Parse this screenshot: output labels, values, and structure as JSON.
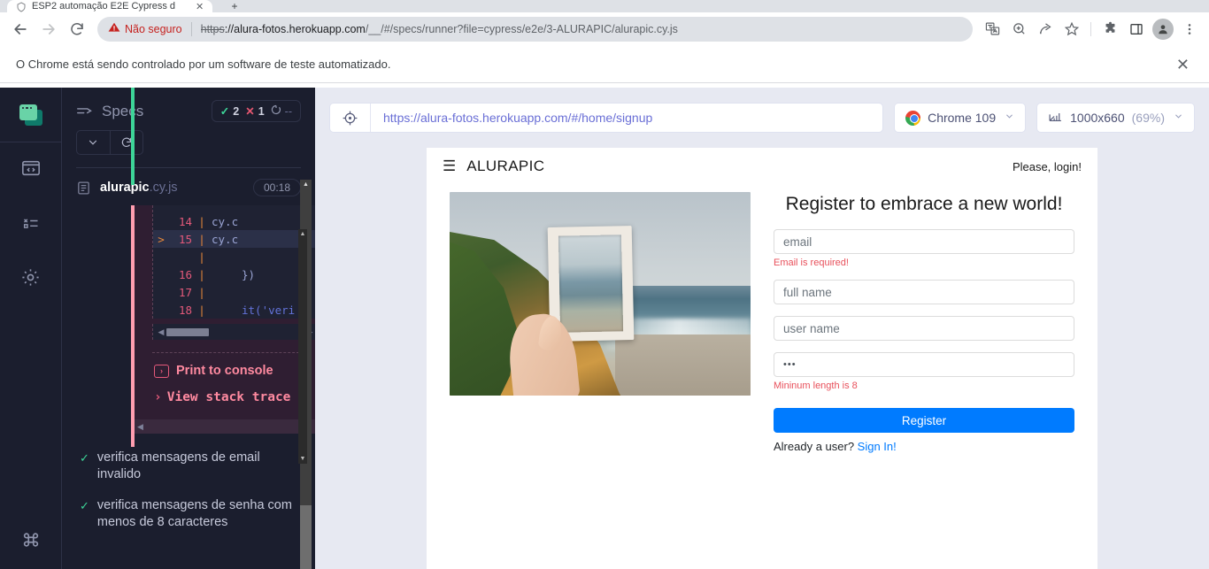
{
  "browser": {
    "tab": {
      "title": "ESP2 automação E2E Cypress d",
      "favicon_name": "shield-icon",
      "close_label": "✕"
    },
    "new_tab_label": "+",
    "nav": {
      "back": "←",
      "forward": "→",
      "reload": "⟳"
    },
    "omnibox": {
      "security_label": "Não seguro",
      "security_icon": "warning-triangle-icon",
      "url_scheme": "https",
      "url_rest": "://alura-fotos.herokuapp.com/__/#/specs/runner?file=cypress/e2e/3-ALURAPIC/alurapic.cy.js",
      "url_host": "://alura-fotos.herokuapp.com",
      "url_path": "/__/#/specs/runner?file=cypress/e2e/3-ALURAPIC/alurapic.cy.js"
    },
    "toolbar_icons": [
      "translate-icon",
      "zoom-icon",
      "share-icon",
      "bookmark-star-icon",
      "extensions-puzzle-icon",
      "side-panel-icon",
      "profile-avatar-icon",
      "three-dot-menu-icon"
    ],
    "infobar": {
      "message": "O Chrome está sendo controlado por um software de teste automatizado.",
      "close_label": "✕"
    }
  },
  "cypress": {
    "rail": [
      {
        "name": "cypress-logo",
        "label": "Cypress"
      },
      {
        "name": "specs-code-icon",
        "label": "Specs"
      },
      {
        "name": "runs-icon",
        "label": "Runs"
      },
      {
        "name": "settings-gear-icon",
        "label": "Settings"
      },
      {
        "name": "keyboard-shortcuts-icon",
        "label": "⌘"
      }
    ],
    "reporter": {
      "specs_label": "Specs",
      "stats": {
        "passed_icon": "✓",
        "passed": "2",
        "failed_icon": "✕",
        "failed": "1",
        "pending_icon": "◴",
        "pending": "--"
      },
      "collapse_label": "⌄",
      "restart_label": "⟳",
      "spec": {
        "name_bold": "alurapic",
        "name_ext": ".cy.js",
        "duration": "00:18",
        "file_icon": "file-document-icon"
      },
      "code_frame": {
        "lines": [
          {
            "marker": "",
            "num": "14",
            "text": "cy.c",
            "highlight": false
          },
          {
            "marker": ">",
            "num": "15",
            "text": "cy.c",
            "highlight": true
          },
          {
            "marker": "",
            "num": "",
            "text": "",
            "highlight": false
          },
          {
            "marker": "",
            "num": "16",
            "text": "})",
            "highlight": false
          },
          {
            "marker": "",
            "num": "17",
            "text": "",
            "highlight": false
          },
          {
            "marker": "",
            "num": "18",
            "text": "it('veri",
            "highlight": false
          }
        ]
      },
      "error_actions": {
        "print_label": "Print to console",
        "print_icon": "console-window-icon",
        "stack_label": "View stack trace",
        "stack_chevron": "›"
      },
      "tests": [
        {
          "status_icon": "✓",
          "label": "verifica mensagens de email invalido"
        },
        {
          "status_icon": "✓",
          "label": "verifica mensagens de senha com menos de 8 caracteres"
        }
      ]
    },
    "aut_toolbar": {
      "selector_playground_icon": "crosshair-target-icon",
      "url": "https://alura-fotos.herokuapp.com/#/home/signup",
      "browser_name": "Chrome 109",
      "browser_icon": "chrome-logo-icon",
      "viewport_icon": "ruler-icon",
      "viewport_size": "1000x660",
      "viewport_scale": "(69%)",
      "chevron": "⌄"
    }
  },
  "app": {
    "brand": "ALURAPIC",
    "burger_icon": "hamburger-menu-icon",
    "login_link": "Please, login!",
    "photo_alt": "hand holding white picture frame over coastal cliff and ocean",
    "form": {
      "title": "Register to embrace a new world!",
      "email_placeholder": "email",
      "email_error": "Email is required!",
      "fullname_placeholder": "full name",
      "username_placeholder": "user name",
      "password_value": "•••",
      "password_error": "Mininum length is 8",
      "submit_label": "Register",
      "footer_text": "Already a user? ",
      "footer_link": "Sign In!"
    }
  },
  "colors": {
    "cypress_bg": "#1b1e2e",
    "pass_green": "#3dd598",
    "fail_red": "#e45770",
    "error_panel": "#2f1e32",
    "link_blue": "#007bff",
    "accent_purple": "#6a6fd6"
  }
}
